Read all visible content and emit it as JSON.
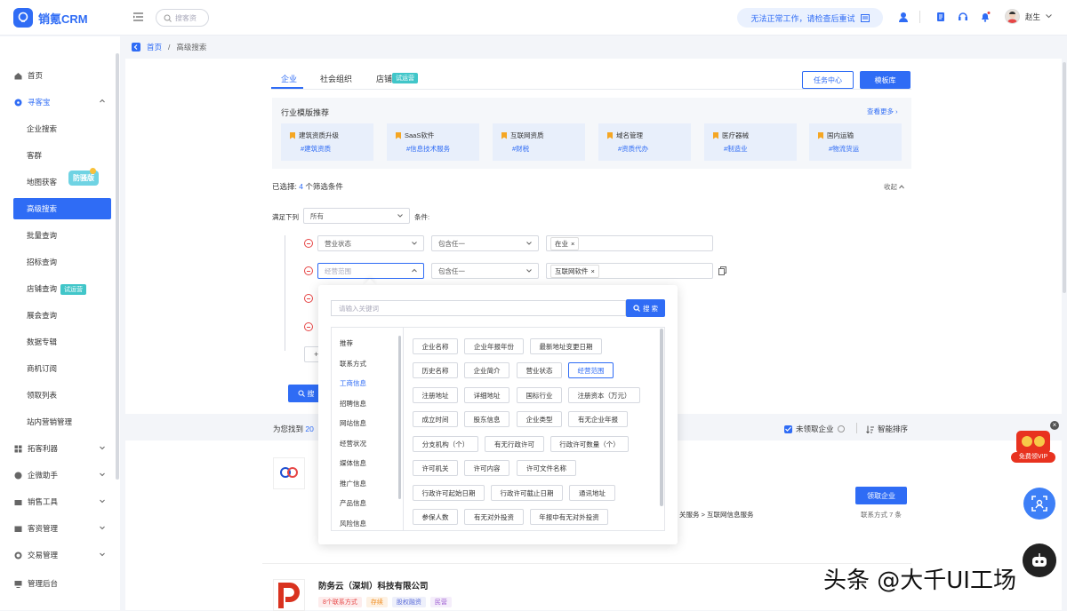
{
  "app": {
    "name": "销氪CRM"
  },
  "header": {
    "search_placeholder": "搜客资",
    "notice": "无法正常工作，请检查后重试",
    "user_name": "赵生"
  },
  "sidebar": {
    "items": [
      {
        "label": "首页"
      },
      {
        "label": "寻客宝"
      },
      {
        "label": "企业搜索"
      },
      {
        "label": "客群"
      },
      {
        "label": "地图获客"
      },
      {
        "label": "高级搜索"
      },
      {
        "label": "批量查询"
      },
      {
        "label": "招标查询"
      },
      {
        "label": "店铺查询"
      },
      {
        "label": "展会查询"
      },
      {
        "label": "数据专辑"
      },
      {
        "label": "商机订阅"
      },
      {
        "label": "领取列表"
      },
      {
        "label": "站内营销管理"
      },
      {
        "label": "拓客利器"
      },
      {
        "label": "企微助手"
      },
      {
        "label": "销售工具"
      },
      {
        "label": "客资管理"
      },
      {
        "label": "交易管理"
      },
      {
        "label": "管理后台"
      }
    ],
    "badge_fangjia": "防骚版",
    "badge_trial": "试运营"
  },
  "breadcrumb": {
    "home": "首页",
    "sep": "/",
    "current": "高级搜索"
  },
  "tabs": [
    {
      "label": "企业"
    },
    {
      "label": "社会组织"
    },
    {
      "label": "店铺"
    }
  ],
  "tab_badge": "试运营",
  "buttons": {
    "task_center": "任务中心",
    "template": "模板库",
    "search": "搜",
    "claim": "领取企业"
  },
  "industry": {
    "title": "行业模版推荐",
    "more": "查看更多 ›",
    "cards": [
      {
        "name": "建筑资质升级",
        "tag": "#建筑资质"
      },
      {
        "name": "SaaS软件",
        "tag": "#信息技术服务"
      },
      {
        "name": "互联网资质",
        "tag": "#财税"
      },
      {
        "name": "域名管理",
        "tag": "#资质代办"
      },
      {
        "name": "医疗器械",
        "tag": "#制造业"
      },
      {
        "name": "国内运输",
        "tag": "#物流货运"
      }
    ]
  },
  "filter": {
    "selected_prefix": "已选择:",
    "selected_count": "4",
    "selected_suffix": "个筛选条件",
    "collapse": "收起",
    "satisfy_label": "满足下列",
    "satisfy_value": "所有",
    "cond_label": "条件:",
    "rows": [
      {
        "field": "营业状态",
        "op": "包含任一",
        "chip": "在业"
      },
      {
        "field": "经营范围",
        "op": "包含任一",
        "chip": "互联网软件"
      }
    ]
  },
  "dropdown": {
    "placeholder": "请输入关键词",
    "search": "搜 索",
    "categories": [
      "推荐",
      "联系方式",
      "工商信息",
      "招聘信息",
      "网站信息",
      "经营状况",
      "媒体信息",
      "推广信息",
      "产品信息",
      "风险信息"
    ],
    "options": [
      [
        "企业名称",
        "企业年报年份",
        "最新地址变更日期"
      ],
      [
        "历史名称",
        "企业简介",
        "营业状态",
        "经营范围"
      ],
      [
        "注册地址",
        "详细地址",
        "国标行业",
        "注册资本（万元）"
      ],
      [
        "成立时间",
        "股东信息",
        "企业类型",
        "有无企业年报"
      ],
      [
        "分支机构（个）",
        "有无行政许可",
        "行政许可数量（个）"
      ],
      [
        "许可机关",
        "许可内容",
        "许可文件名称"
      ],
      [
        "行政许可起始日期",
        "行政许可截止日期",
        "通讯地址"
      ],
      [
        "参保人数",
        "有无对外投资",
        "年报中有无对外投资"
      ]
    ],
    "selected_option": "经营范围"
  },
  "results": {
    "found_prefix": "为您找到",
    "found_count": "20",
    "unclaimed": "未领取企业",
    "smart_sort": "智能排序",
    "company2_name": "防务云（深圳）科技有限公司",
    "company2_tags": [
      "8个联系方式",
      "存续",
      "股权融资",
      "民营"
    ],
    "industry_path": "关服务 > 互联网信息服务",
    "contact_count": "联系方式 7 条",
    "vip": "免费领VIP"
  },
  "watermark": "头条 @大千UI工场"
}
